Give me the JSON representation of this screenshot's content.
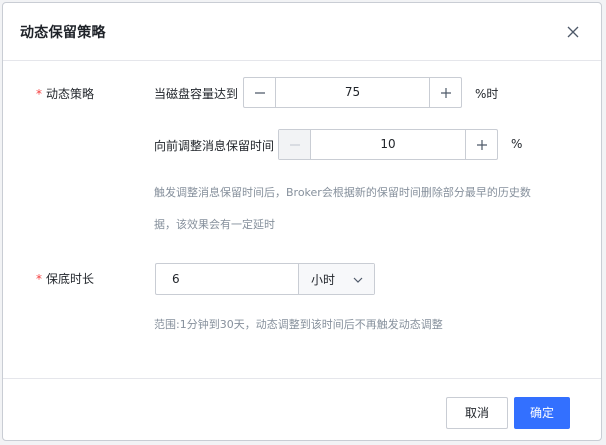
{
  "dialog": {
    "title": "动态保留策略",
    "close_icon": "close-icon"
  },
  "strategy": {
    "label": "动态策略",
    "required_mark": "*",
    "disk_label": "当磁盘容量达到",
    "disk_value": "75",
    "disk_unit": "%时",
    "adjust_label": "向前调整消息保留时间",
    "adjust_value": "10",
    "adjust_unit": "%",
    "help_line1": "触发调整消息保留时间后，Broker会根据新的保留时间删除部分最早的历史数",
    "help_line2": "据，该效果会有一定延时"
  },
  "floor": {
    "label": "保底时长",
    "required_mark": "*",
    "value": "6",
    "unit_selected": "小时",
    "help": "范围:1分钟到30天，动态调整到该时间后不再触发动态调整"
  },
  "footer": {
    "cancel_label": "取消",
    "ok_label": "确定"
  },
  "colors": {
    "primary": "#3370ff",
    "required": "#f53f3f",
    "help_text": "#86909c"
  }
}
